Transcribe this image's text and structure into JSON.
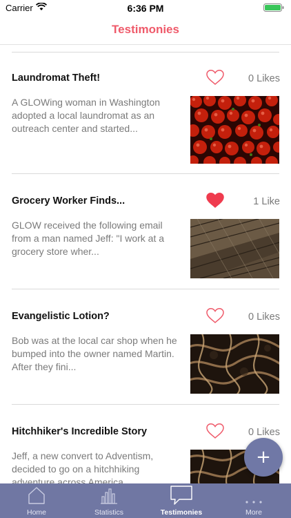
{
  "status_bar": {
    "carrier": "Carrier",
    "time": "6:36 PM"
  },
  "nav": {
    "title": "Testimonies"
  },
  "testimonies": [
    {
      "title": "Laundromat Theft!",
      "likes": "0 Likes",
      "liked": false,
      "description": "A GLOWing woman in Washington adopted a local laundromat as an outreach center and started..."
    },
    {
      "title": "Grocery Worker Finds...",
      "likes": "1 Like",
      "liked": true,
      "description": "GLOW received the following email from a man named Jeff: \"I work at a grocery store wher..."
    },
    {
      "title": "Evangelistic Lotion?",
      "likes": "0 Likes",
      "liked": false,
      "description": "Bob was at the local car shop when he bumped into the owner named Martin. After they fini..."
    },
    {
      "title": "Hitchhiker's Incredible Story",
      "likes": "0 Likes",
      "liked": false,
      "description": "Jeff, a new convert to Adventism, decided to go on a hitchhiking adventure across America..."
    }
  ],
  "fab": {
    "icon": "+"
  },
  "tabs": [
    {
      "label": "Home",
      "icon": "home-icon"
    },
    {
      "label": "Statistics",
      "icon": "statistics-icon"
    },
    {
      "label": "Testimonies",
      "icon": "speech-bubble-icon",
      "active": true
    },
    {
      "label": "More",
      "icon": "more-icon"
    }
  ],
  "colors": {
    "accent": "#ef5a6a",
    "tabbar": "#7077a3",
    "heart_filled": "#ef3b4e"
  }
}
